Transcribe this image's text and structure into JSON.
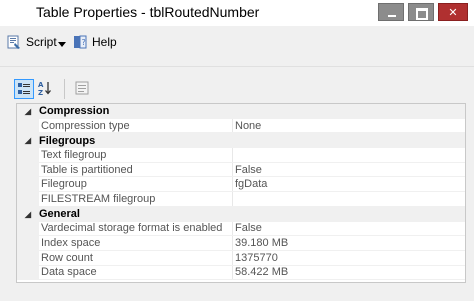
{
  "window": {
    "title": "Table Properties - tblRoutedNumber"
  },
  "toolbar": {
    "script_label": "Script",
    "help_label": "Help"
  },
  "categories": [
    {
      "name": "Compression",
      "properties": [
        {
          "name": "Compression type",
          "value": "None"
        }
      ]
    },
    {
      "name": "Filegroups",
      "properties": [
        {
          "name": "Text filegroup",
          "value": ""
        },
        {
          "name": "Table is partitioned",
          "value": "False"
        },
        {
          "name": "Filegroup",
          "value": "fgData"
        },
        {
          "name": "FILESTREAM filegroup",
          "value": ""
        }
      ]
    },
    {
      "name": "General",
      "properties": [
        {
          "name": "Vardecimal storage format is enabled",
          "value": "False"
        },
        {
          "name": "Index space",
          "value": "39.180 MB"
        },
        {
          "name": "Row count",
          "value": "1375770"
        },
        {
          "name": "Data space",
          "value": "58.422 MB"
        }
      ]
    }
  ]
}
